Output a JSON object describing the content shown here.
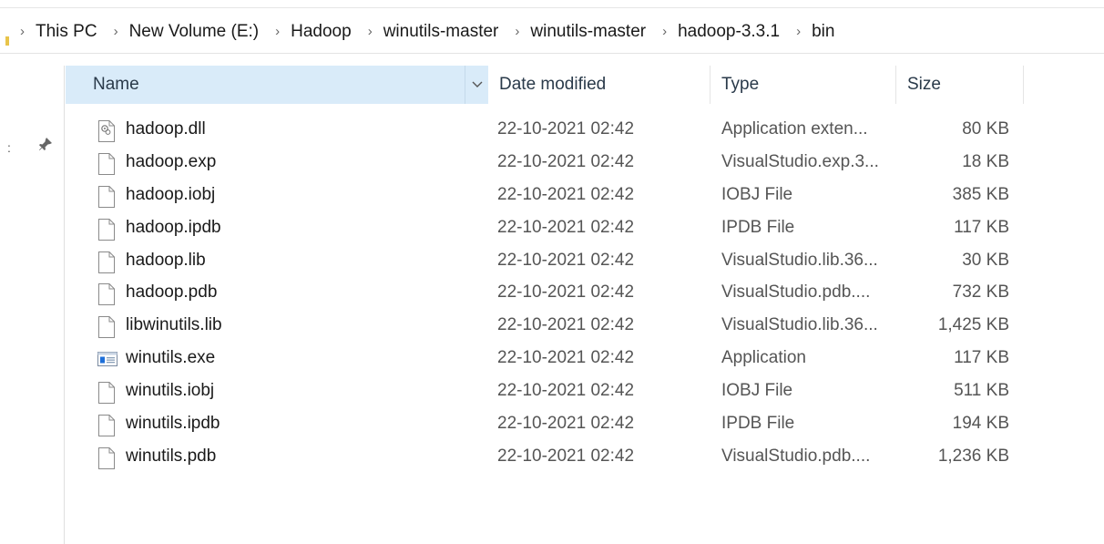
{
  "breadcrumb": [
    "This PC",
    "New Volume (E:)",
    "Hadoop",
    "winutils-master",
    "winutils-master",
    "hadoop-3.3.1",
    "bin"
  ],
  "columns": {
    "name": "Name",
    "date": "Date modified",
    "type": "Type",
    "size": "Size"
  },
  "files": [
    {
      "name": "hadoop.dll",
      "date": "22-10-2021 02:42",
      "type": "Application exten...",
      "size": "80 KB",
      "icon": "dll-file-icon"
    },
    {
      "name": "hadoop.exp",
      "date": "22-10-2021 02:42",
      "type": "VisualStudio.exp.3...",
      "size": "18 KB",
      "icon": "file-icon"
    },
    {
      "name": "hadoop.iobj",
      "date": "22-10-2021 02:42",
      "type": "IOBJ File",
      "size": "385 KB",
      "icon": "file-icon"
    },
    {
      "name": "hadoop.ipdb",
      "date": "22-10-2021 02:42",
      "type": "IPDB File",
      "size": "117 KB",
      "icon": "file-icon"
    },
    {
      "name": "hadoop.lib",
      "date": "22-10-2021 02:42",
      "type": "VisualStudio.lib.36...",
      "size": "30 KB",
      "icon": "file-icon"
    },
    {
      "name": "hadoop.pdb",
      "date": "22-10-2021 02:42",
      "type": "VisualStudio.pdb....",
      "size": "732 KB",
      "icon": "file-icon"
    },
    {
      "name": "libwinutils.lib",
      "date": "22-10-2021 02:42",
      "type": "VisualStudio.lib.36...",
      "size": "1,425 KB",
      "icon": "file-icon"
    },
    {
      "name": "winutils.exe",
      "date": "22-10-2021 02:42",
      "type": "Application",
      "size": "117 KB",
      "icon": "exe-file-icon"
    },
    {
      "name": "winutils.iobj",
      "date": "22-10-2021 02:42",
      "type": "IOBJ File",
      "size": "511 KB",
      "icon": "file-icon"
    },
    {
      "name": "winutils.ipdb",
      "date": "22-10-2021 02:42",
      "type": "IPDB File",
      "size": "194 KB",
      "icon": "file-icon"
    },
    {
      "name": "winutils.pdb",
      "date": "22-10-2021 02:42",
      "type": "VisualStudio.pdb....",
      "size": "1,236 KB",
      "icon": "file-icon"
    }
  ],
  "colors": {
    "header_selected_bg": "#d9ebf9",
    "folder_accent": "#e8c44a",
    "exe_accent": "#1e6fd9"
  }
}
